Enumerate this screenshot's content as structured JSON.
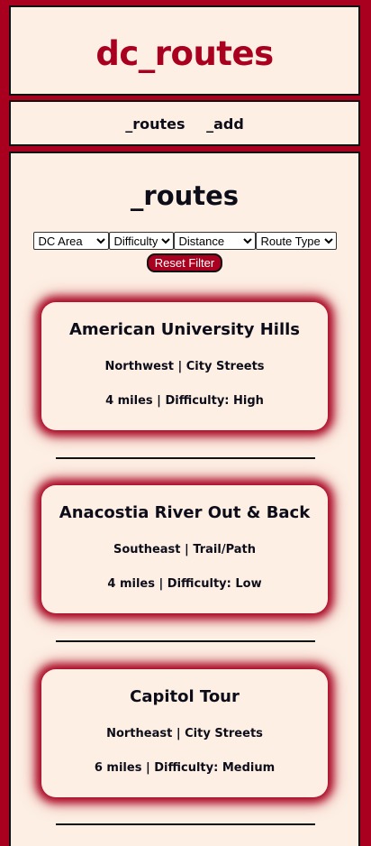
{
  "header": {
    "title": "dc_routes"
  },
  "nav": {
    "routes_label": "_routes",
    "add_label": "_add"
  },
  "main": {
    "heading": "_routes",
    "filters": {
      "area": "DC Area",
      "difficulty": "Difficulty",
      "distance": "Distance",
      "route_type": "Route Type"
    },
    "reset_label": "Reset Filter",
    "routes": [
      {
        "name": "American University Hills",
        "meta": "Northwest | City Streets",
        "stats": "4 miles | Difficulty: High"
      },
      {
        "name": "Anacostia River Out & Back",
        "meta": "Southeast | Trail/Path",
        "stats": "4 miles | Difficulty: Low"
      },
      {
        "name": "Capitol Tour",
        "meta": "Northeast | City Streets",
        "stats": "6 miles | Difficulty: Medium"
      }
    ]
  },
  "colors": {
    "accent": "#a8001e",
    "panel": "#fdefe4",
    "text": "#0d0d1a"
  }
}
